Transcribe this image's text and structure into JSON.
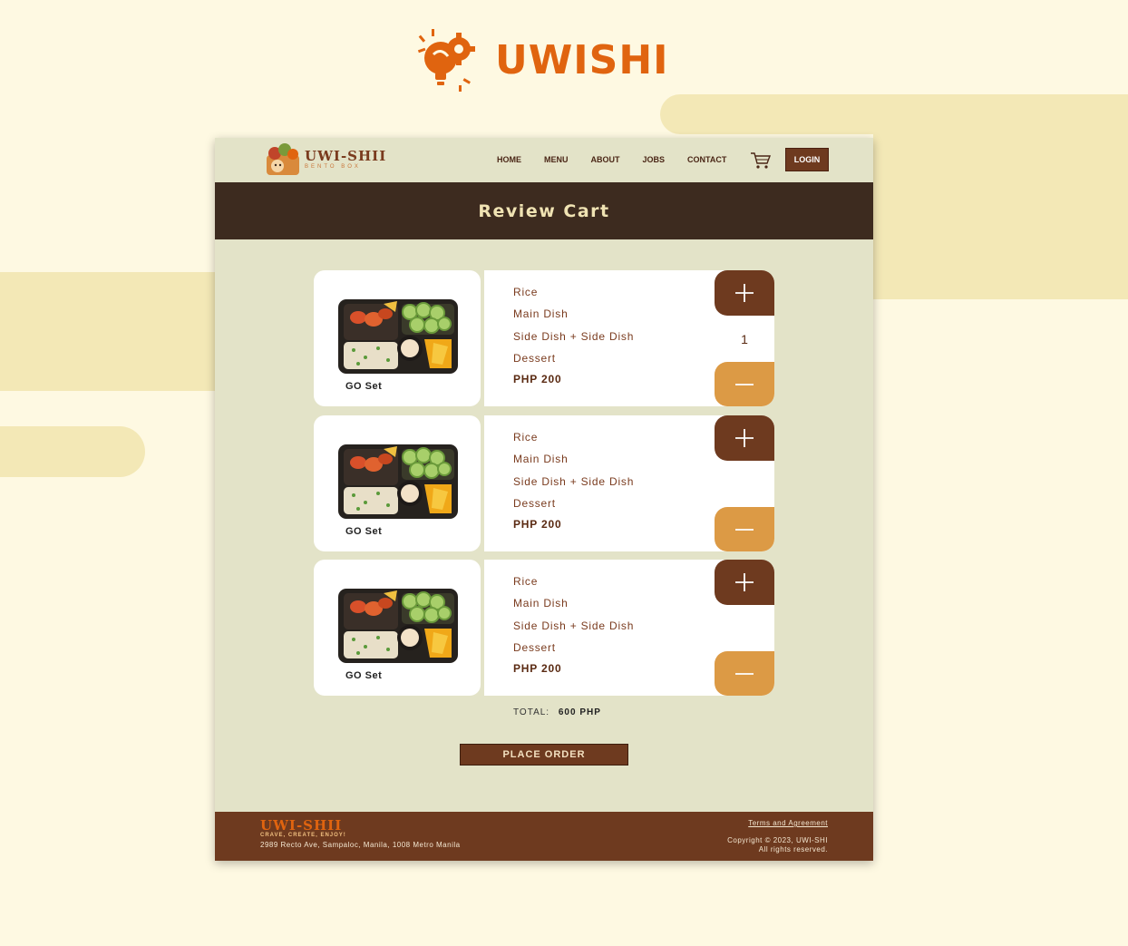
{
  "brand": {
    "name": "UWISHI"
  },
  "site": {
    "logo_name": "UWI-SHII",
    "logo_tagline": "BENTO BOX"
  },
  "nav": {
    "items": [
      "HOME",
      "MENU",
      "ABOUT",
      "JOBS",
      "CONTACT"
    ],
    "login_label": "LOGIN"
  },
  "hero": {
    "title": "Review Cart"
  },
  "cart": {
    "items": [
      {
        "name": "GO Set",
        "details": [
          "Rice",
          "Main Dish",
          "Side Dish + Side Dish",
          "Dessert"
        ],
        "price": "PHP 200",
        "quantity": "1"
      },
      {
        "name": "GO Set",
        "details": [
          "Rice",
          "Main Dish",
          "Side Dish + Side Dish",
          "Dessert"
        ],
        "price": "PHP 200",
        "quantity": ""
      },
      {
        "name": "GO Set",
        "details": [
          "Rice",
          "Main Dish",
          "Side Dish + Side Dish",
          "Dessert"
        ],
        "price": "PHP 200",
        "quantity": ""
      }
    ],
    "total_label": "TOTAL:",
    "total_value": "600 PHP",
    "order_label": "PLACE ORDER"
  },
  "footer": {
    "logo_name": "UWI-SHII",
    "tagline": "CRAVE, CREATE, ENJOY!",
    "address": "2989 Recto Ave, Sampaloc, Manila, 1008 Metro Manila",
    "terms": "Terms and Agreement",
    "copyright_line1": "Copyright © 2023, UWI-SHI",
    "copyright_line2": "All rights reserved."
  },
  "icons": {
    "brand": "lightbulb-gear-icon",
    "cart": "shopping-cart-icon",
    "plus": "plus-icon",
    "minus": "minus-icon"
  },
  "colors": {
    "background": "#fef9e2",
    "accent": "#e0640f",
    "brown": "#6e3a1f",
    "dark_brown": "#3d2b1f",
    "orange": "#dc9a45",
    "panel": "#e3e3c8"
  }
}
